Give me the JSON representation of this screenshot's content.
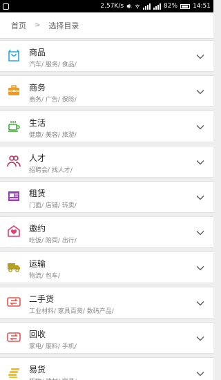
{
  "status_bar": {
    "network_speed": "2.57K/s",
    "battery": "82%",
    "time": "14:51"
  },
  "breadcrumb": {
    "home": "首页",
    "separator": ">",
    "current": "选择目录"
  },
  "categories": [
    {
      "title": "商品",
      "sub": "汽车/ 服务/ 食品/",
      "icon": "shopping-bag-icon",
      "color": "#29a9e0"
    },
    {
      "title": "商务",
      "sub": "商务/ 广告/ 保险/",
      "icon": "briefcase-icon",
      "color": "#f29a1f"
    },
    {
      "title": "生活",
      "sub": "健康/ 美容/ 旅游/",
      "icon": "coffee-cup-icon",
      "color": "#3cb034"
    },
    {
      "title": "人才",
      "sub": "招聘会/ 找人才/",
      "icon": "people-icon",
      "color": "#c0305a"
    },
    {
      "title": "租赁",
      "sub": "门面/ 店铺/ 转卖/",
      "icon": "rental-icon",
      "color": "#9b3fb6"
    },
    {
      "title": "邀约",
      "sub": "吃饭/ 陪同/ 出行/",
      "icon": "invitation-icon",
      "color": "#e63a6a"
    },
    {
      "title": "运输",
      "sub": "物流/ 包车/",
      "icon": "truck-icon",
      "color": "#b5a020"
    },
    {
      "title": "二手货",
      "sub": "工业材料/ 家具百货/ 数码产品/",
      "icon": "recycle-icon",
      "color": "#e8504a"
    },
    {
      "title": "回收",
      "sub": "家电/ 废料/ 手机/",
      "icon": "recycle-icon",
      "color": "#e8504a"
    },
    {
      "title": "易货",
      "sub": "货物/ 建材/ 家具/",
      "icon": "coins-icon",
      "color": "#f2c20f"
    }
  ]
}
